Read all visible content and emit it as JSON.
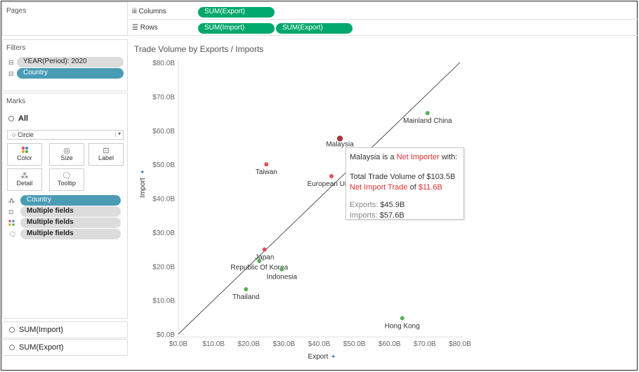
{
  "left": {
    "pages_title": "Pages",
    "filters_title": "Filters",
    "filters": [
      "YEAR(Period): 2020",
      "Country"
    ],
    "marks_title": "Marks",
    "marks_all": "All",
    "mark_type": "Circle",
    "mark_buttons": [
      "Color",
      "Size",
      "Label",
      "Detail",
      "Tooltip"
    ],
    "mark_fields": [
      "Country",
      "Multiple fields",
      "Multiple fields",
      "Multiple fields"
    ],
    "measures": [
      "SUM(Import)",
      "SUM(Export)"
    ]
  },
  "shelves": {
    "columns_label": "Columns",
    "columns_pill": "SUM(Export)",
    "rows_label": "Rows",
    "rows_pills": [
      "SUM(Import)",
      "SUM(Export)"
    ]
  },
  "tooltip": {
    "country": "Malaysia",
    "is_a": " is a ",
    "status": "Net Importer",
    "with": " with:",
    "total_label": "Total Trade Volume of ",
    "total_value": "$103.5B",
    "net_label": "Net Import Trade",
    "net_of": " of ",
    "net_value": "$11.6B",
    "exports_label": "Exports:",
    "exports_value": "$45.9B",
    "imports_label": "Imports:",
    "imports_value": "$57.6B"
  },
  "chart_data": {
    "type": "scatter",
    "title": "Trade Volume by Exports / Imports",
    "xlabel": "Export",
    "ylabel": "Import",
    "xlim": [
      0,
      80
    ],
    "ylim": [
      0,
      80
    ],
    "x_ticks": [
      "$0.0B",
      "$10.0B",
      "$20.0B",
      "$30.0B",
      "$40.0B",
      "$50.0B",
      "$60.0B",
      "$70.0B",
      "$80.0B"
    ],
    "y_ticks": [
      "$0.0B",
      "$10.0B",
      "$20.0B",
      "$30.0B",
      "$40.0B",
      "$50.0B",
      "$60.0B",
      "$70.0B",
      "$80.0B"
    ],
    "reference_line": "y = x",
    "colors": {
      "net_importer": "#e0505a",
      "net_exporter": "#59b25a",
      "highlight": "#c0313b"
    },
    "points": [
      {
        "label": "Mainland China",
        "x": 70.8,
        "y": 65.1,
        "status": "net_exporter"
      },
      {
        "label": "Malaysia",
        "x": 45.9,
        "y": 57.6,
        "status": "net_importer",
        "highlighted": true
      },
      {
        "label": "Taiwan",
        "x": 25.0,
        "y": 50.0,
        "status": "net_importer"
      },
      {
        "label": "European Un",
        "x": 43.5,
        "y": 46.5,
        "status": "net_importer"
      },
      {
        "label": "Japan",
        "x": 24.5,
        "y": 24.9,
        "status": "net_importer"
      },
      {
        "label": "Republic Of Korea",
        "x": 23.0,
        "y": 21.5,
        "status": "net_exporter"
      },
      {
        "label": "Indonesia",
        "x": 29.4,
        "y": 19.1,
        "status": "net_exporter"
      },
      {
        "label": "Thailand",
        "x": 19.2,
        "y": 13.2,
        "status": "net_exporter"
      },
      {
        "label": "Hong Kong",
        "x": 63.6,
        "y": 4.7,
        "status": "net_exporter"
      }
    ]
  }
}
